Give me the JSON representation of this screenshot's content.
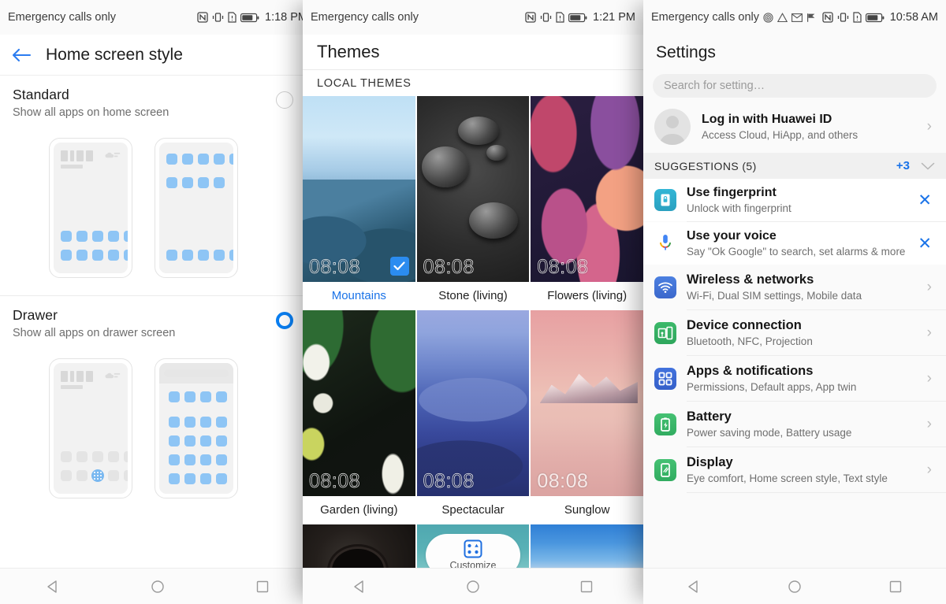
{
  "left_panel": {
    "status": {
      "carrier": "Emergency calls only",
      "time": "1:18 PM",
      "icons": [
        "nfc-icon",
        "vibrate-icon",
        "sim-alert-icon",
        "battery-icon"
      ]
    },
    "header": {
      "back_icon": "back-arrow-icon",
      "title": "Home screen style"
    },
    "options": [
      {
        "name": "Standard",
        "desc": "Show all apps on home screen",
        "selected": false
      },
      {
        "name": "Drawer",
        "desc": "Show all apps on drawer screen",
        "selected": true
      }
    ],
    "nav": [
      "back-nav-icon",
      "home-nav-icon",
      "recents-nav-icon"
    ]
  },
  "mid_panel": {
    "status": {
      "carrier": "Emergency calls only",
      "time": "1:21 PM",
      "icons": [
        "nfc-icon",
        "vibrate-icon",
        "sim-alert-icon",
        "battery-icon"
      ]
    },
    "header": {
      "title": "Themes"
    },
    "section_header": "LOCAL THEMES",
    "themes": [
      {
        "caption": "Mountains",
        "clock": "08:08",
        "selected": true,
        "art": "w-mountains"
      },
      {
        "caption": "Stone (living)",
        "clock": "08:08",
        "selected": false,
        "art": "w-stone"
      },
      {
        "caption": "Flowers (living)",
        "clock": "08:08",
        "selected": false,
        "art": "w-flowers"
      },
      {
        "caption": "Garden (living)",
        "clock": "08:08",
        "selected": false,
        "art": "w-garden"
      },
      {
        "caption": "Spectacular",
        "clock": "08:08",
        "selected": false,
        "art": "w-spectacular"
      },
      {
        "caption": "Sunglow",
        "clock": "08:08",
        "selected": false,
        "art": "w-sunglow"
      }
    ],
    "partial_row": [
      {
        "caption": "",
        "art": "w-guitar"
      },
      {
        "caption": "Customize",
        "art": "w-teal",
        "icon": "customize-icon"
      },
      {
        "caption": "",
        "art": "w-sky"
      }
    ],
    "nav": [
      "back-nav-icon",
      "home-nav-icon",
      "recents-nav-icon"
    ]
  },
  "right_panel": {
    "status": {
      "carrier": "Emergency calls only",
      "time": "10:58 AM",
      "left_icons": [
        "fingerprint-icon",
        "warning-icon",
        "mail-icon",
        "flag-icon"
      ],
      "right_icons": [
        "nfc-icon",
        "vibrate-icon",
        "sim-alert-icon",
        "battery-icon"
      ]
    },
    "header": {
      "title": "Settings"
    },
    "search": {
      "placeholder": "Search for setting…"
    },
    "account": {
      "title": "Log in with Huawei ID",
      "subtitle": "Access Cloud, HiApp, and others"
    },
    "suggestions_header": {
      "label": "SUGGESTIONS (5)",
      "more": "+3"
    },
    "suggestions": [
      {
        "title": "Use fingerprint",
        "subtitle": "Unlock with fingerprint",
        "icon": "fingerprint-lock-icon"
      },
      {
        "title": "Use your voice",
        "subtitle": "Say \"Ok Google\" to search, set alarms & more",
        "icon": "google-mic-icon"
      }
    ],
    "settings": [
      {
        "title": "Wireless & networks",
        "subtitle": "Wi-Fi, Dual SIM settings, Mobile data",
        "icon": "wifi-icon",
        "color": "ic-blue"
      },
      {
        "title": "Device connection",
        "subtitle": "Bluetooth, NFC, Projection",
        "icon": "device-icon",
        "color": "ic-green"
      },
      {
        "title": "Apps & notifications",
        "subtitle": "Permissions, Default apps, App twin",
        "icon": "apps-icon",
        "color": "ic-blue2"
      },
      {
        "title": "Battery",
        "subtitle": "Power saving mode, Battery usage",
        "icon": "battery-app-icon",
        "color": "ic-green2"
      },
      {
        "title": "Display",
        "subtitle": "Eye comfort, Home screen style, Text style",
        "icon": "display-icon",
        "color": "ic-green2"
      }
    ],
    "nav": [
      "back-nav-icon",
      "home-nav-icon",
      "recents-nav-icon"
    ]
  },
  "colors": {
    "accent": "#1a73e8",
    "selected_blue": "#0a7ff2",
    "check_blue": "#2b8cf0"
  }
}
